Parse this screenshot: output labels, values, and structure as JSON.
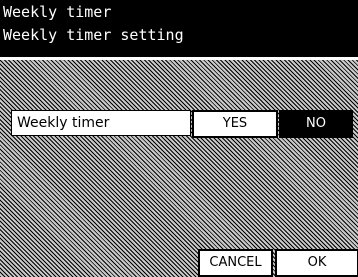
{
  "header": {
    "title": "Weekly timer",
    "subtitle": "Weekly timer setting"
  },
  "setting": {
    "label": "Weekly timer",
    "options": [
      {
        "label": "YES",
        "selected": false
      },
      {
        "label": "NO",
        "selected": true
      }
    ]
  },
  "footer": {
    "cancel_label": "CANCEL",
    "ok_label": "OK"
  },
  "colors": {
    "header_bg": "#000000",
    "selected_bg": "#000000",
    "unselected_bg": "#ffffff"
  }
}
